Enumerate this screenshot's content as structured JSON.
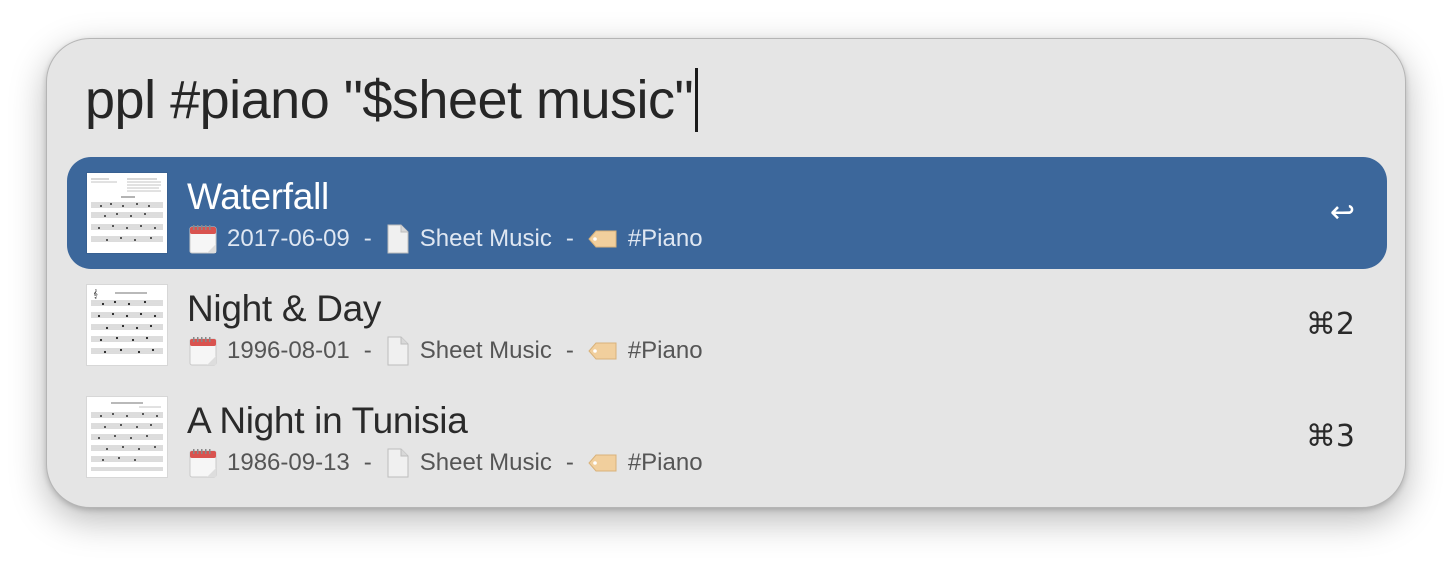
{
  "query": {
    "text": "ppl #piano \"$sheet music\""
  },
  "results": [
    {
      "title": "Waterfall",
      "date": "2017-06-09",
      "type": "Sheet Music",
      "tag": "#Piano",
      "shortcut": "↩",
      "selected": true,
      "thumbnail_icon": "sheet-music-thumbnail"
    },
    {
      "title": "Night & Day",
      "date": "1996-08-01",
      "type": "Sheet Music",
      "tag": "#Piano",
      "shortcut": "⌘2",
      "selected": false,
      "thumbnail_icon": "sheet-music-thumbnail"
    },
    {
      "title": "A Night in Tunisia",
      "date": "1986-09-13",
      "type": "Sheet Music",
      "tag": "#Piano",
      "shortcut": "⌘3",
      "selected": false,
      "thumbnail_icon": "sheet-music-thumbnail"
    }
  ],
  "meta_separator": "-",
  "icons": {
    "date": "calendar-icon",
    "type": "document-icon",
    "tag": "tag-icon"
  },
  "colors": {
    "selection": "#3c679b",
    "panel": "#e5e5e5",
    "tag_fill": "#f1cf9d"
  }
}
